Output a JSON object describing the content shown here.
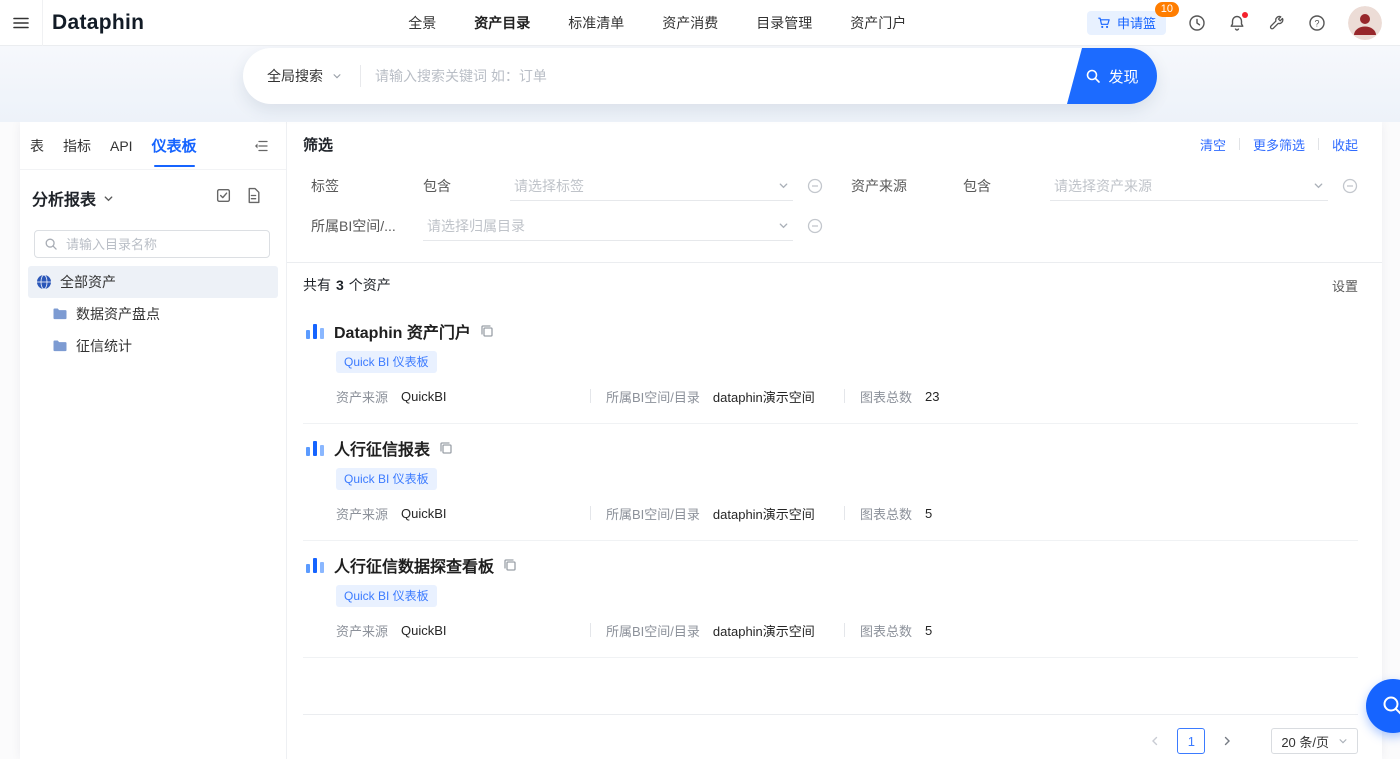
{
  "colors": {
    "accent": "#1664ff",
    "badge": "#ff7d00",
    "tag_bg": "#e9f1ff"
  },
  "topbar": {
    "logo": "Dataphin",
    "nav": [
      {
        "label": "全景"
      },
      {
        "label": "资产目录"
      },
      {
        "label": "标准清单"
      },
      {
        "label": "资产消费"
      },
      {
        "label": "目录管理"
      },
      {
        "label": "资产门户"
      }
    ],
    "active_nav": "资产目录",
    "basket": {
      "label": "申请篮",
      "badge": "10"
    },
    "icons": [
      "history-icon",
      "bell-icon",
      "tools-icon",
      "help-icon",
      "avatar"
    ]
  },
  "global_search": {
    "scope": "全局搜索",
    "placeholder": "请输入搜索关键词 如：订单",
    "button": "发现"
  },
  "sidebar": {
    "tabs": [
      {
        "label": "表"
      },
      {
        "label": "指标"
      },
      {
        "label": "API"
      },
      {
        "label": "仪表板"
      }
    ],
    "active_tab": "仪表板",
    "group": "分析报表",
    "search_placeholder": "请输入目录名称",
    "tree": [
      {
        "label": "全部资产",
        "icon": "globe-icon",
        "selected": true
      },
      {
        "label": "数据资产盘点",
        "icon": "folder-icon",
        "selected": false
      },
      {
        "label": "征信统计",
        "icon": "folder-icon",
        "selected": false
      }
    ]
  },
  "filter": {
    "title": "筛选",
    "clear": "清空",
    "more": "更多筛选",
    "collapse": "收起",
    "rows": [
      {
        "label": "标签",
        "op": "包含",
        "placeholder": "请选择标签"
      },
      {
        "label": "资产来源",
        "op": "包含",
        "placeholder": "请选择资产来源"
      },
      {
        "label": "所属BI空间/...",
        "placeholder": "请选择归属目录"
      }
    ]
  },
  "results": {
    "summary_prefix": "共有",
    "count": "3",
    "summary_suffix": "个资产",
    "settings": "设置",
    "meta_labels": {
      "source": "资产来源",
      "space": "所属BI空间/目录",
      "charts": "图表总数"
    },
    "items": [
      {
        "title": "Dataphin 资产门户",
        "tag": "Quick BI 仪表板",
        "source": "QuickBI",
        "space": "dataphin演示空间",
        "charts": "23"
      },
      {
        "title": "人行征信报表",
        "tag": "Quick BI 仪表板",
        "source": "QuickBI",
        "space": "dataphin演示空间",
        "charts": "5"
      },
      {
        "title": "人行征信数据探查看板",
        "tag": "Quick BI 仪表板",
        "source": "QuickBI",
        "space": "dataphin演示空间",
        "charts": "5"
      }
    ]
  },
  "pagination": {
    "page": "1",
    "page_size": "20 条/页"
  }
}
